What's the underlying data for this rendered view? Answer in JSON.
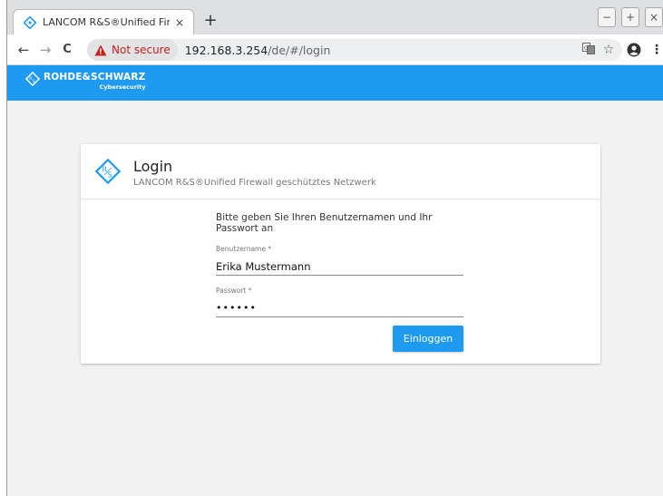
{
  "browser": {
    "tab_title": "LANCOM R&S®Unified Firewall",
    "tab_close": "×",
    "new_tab": "+",
    "window_minimize": "−",
    "window_maximize": "+",
    "window_close": "×",
    "nav_back": "←",
    "nav_forward": "→",
    "nav_reload": "C",
    "security_label": "Not secure",
    "url_host": "192.168.3.254",
    "url_path": "/de/#/login",
    "menu": "⋮"
  },
  "site": {
    "brand_name": "ROHDE&SCHWARZ",
    "brand_sub": "Cybersecurity",
    "accent": "#1e9bf0"
  },
  "login": {
    "title": "Login",
    "subtitle": "LANCOM R&S®Unified Firewall geschütztes Netzwerk",
    "instructions": "Bitte geben Sie Ihren Benutzernamen und Ihr Passwort an",
    "username_label": "Benutzername *",
    "username_value": "Erika Mustermann",
    "password_label": "Passwort *",
    "password_value": "••••••",
    "submit_label": "Einloggen"
  }
}
